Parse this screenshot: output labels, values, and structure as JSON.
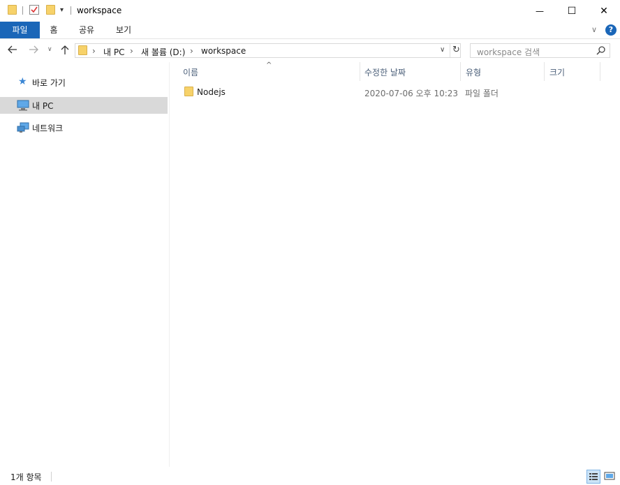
{
  "window": {
    "title": "workspace",
    "minimize_glyph": "—",
    "maximize_glyph": "☐",
    "close_glyph": "✕"
  },
  "ribbon": {
    "tabs": [
      {
        "label": "파일",
        "active": true
      },
      {
        "label": "홈",
        "active": false
      },
      {
        "label": "공유",
        "active": false
      },
      {
        "label": "보기",
        "active": false
      }
    ],
    "help_glyph": "?"
  },
  "address": {
    "crumbs": [
      "내 PC",
      "새 볼륨 (D:)",
      "workspace"
    ],
    "separator": "›"
  },
  "search": {
    "placeholder": "workspace 검색"
  },
  "nav": {
    "items": [
      {
        "label": "바로 가기",
        "icon": "star-icon",
        "selected": false
      },
      {
        "label": "내 PC",
        "icon": "computer-icon",
        "selected": true
      },
      {
        "label": "네트워크",
        "icon": "network-icon",
        "selected": false
      }
    ]
  },
  "columns": {
    "name": "이름",
    "modified": "수정한 날짜",
    "type": "유형",
    "size": "크기"
  },
  "files": [
    {
      "name": "Nodejs",
      "modified": "2020-07-06 오후 10:23",
      "type": "파일 폴더",
      "size": ""
    }
  ],
  "status": {
    "item_count": "1개 항목"
  },
  "colors": {
    "accent": "#1a66b8",
    "selected_bg": "#d9d9d9",
    "folder": "#f7d26a",
    "header_text": "#4c607a"
  }
}
